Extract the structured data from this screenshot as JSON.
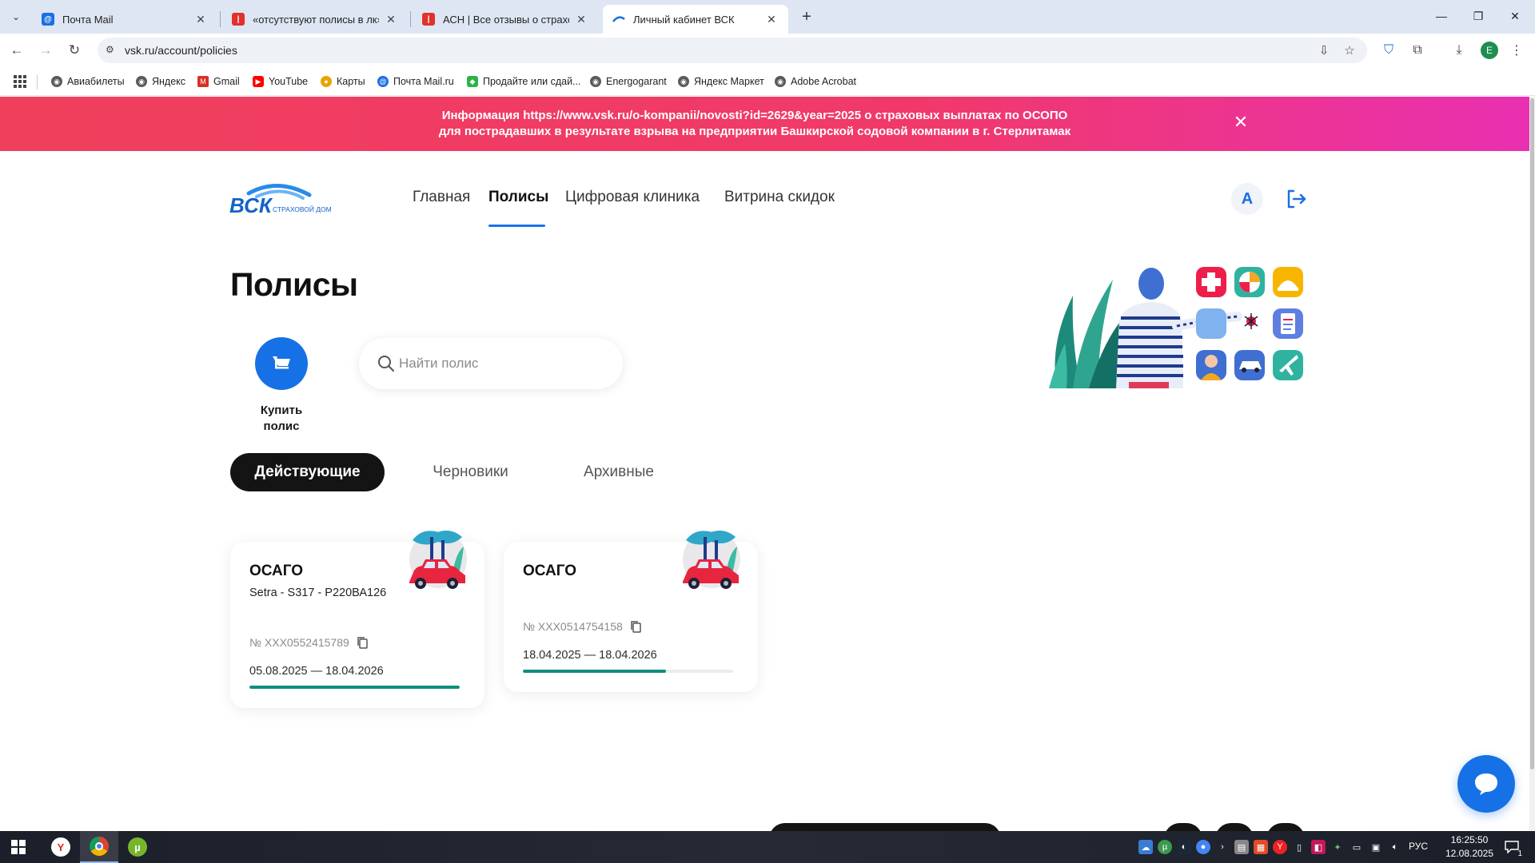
{
  "browser": {
    "tabs": [
      {
        "title": "Почта Mail",
        "favicon_color": "#1a6fe3",
        "active": false
      },
      {
        "title": "«отсутствуют полисы в лк» - о",
        "favicon_color": "#e0312c",
        "active": false
      },
      {
        "title": "АСН | Все отзывы о страховых",
        "favicon_color": "#e0312c",
        "active": false
      },
      {
        "title": "Личный кабинет ВСК",
        "favicon_color": "#1a6fe3",
        "active": true
      }
    ],
    "url": "vsk.ru/account/policies",
    "profile_initial": "E",
    "bookmarks": [
      {
        "label": "Авиабилеты",
        "color": "#5a5a5a"
      },
      {
        "label": "Яндекс",
        "color": "#5a5a5a"
      },
      {
        "label": "Gmail",
        "color": "#d93025"
      },
      {
        "label": "YouTube",
        "color": "#ff0000"
      },
      {
        "label": "Карты",
        "color": "#e8a400"
      },
      {
        "label": "Почта Mail.ru",
        "color": "#1a6fe3"
      },
      {
        "label": "Продайте или сдай...",
        "color": "#2bb34a"
      },
      {
        "label": "Energogarant",
        "color": "#5a5a5a"
      },
      {
        "label": "Яндекс Маркет",
        "color": "#5a5a5a"
      },
      {
        "label": "Adobe Acrobat",
        "color": "#5a5a5a"
      }
    ]
  },
  "banner": {
    "line1": "Информация https://www.vsk.ru/o-kompanii/novosti?id=2629&year=2025 о страховых выплатах по ОСОПО",
    "line2": "для пострадавших в результате взрыва на предприятии Башкирской содовой компании в г. Стерлитамак"
  },
  "header": {
    "logo_text": "ВСК",
    "logo_subtext": "СТРАХОВОЙ ДОМ",
    "nav": [
      "Главная",
      "Полисы",
      "Цифровая клиника",
      "Витрина скидок"
    ],
    "avatar_initial": "А"
  },
  "page": {
    "title": "Полисы",
    "buy_label_line1": "Купить",
    "buy_label_line2": "полис",
    "search_placeholder": "Найти полис",
    "filter_tabs": [
      "Действующие",
      "Черновики",
      "Архивные"
    ]
  },
  "policies": [
    {
      "type": "ОСАГО",
      "vehicle": "Setra - S317 - Р220ВА126",
      "number": "№ XXX0552415789",
      "dates": "05.08.2025 — 18.04.2026",
      "progress": 1.0
    },
    {
      "type": "ОСАГО",
      "vehicle": "",
      "number": "№ XXX0514754158",
      "dates": "18.04.2025 — 18.04.2026",
      "progress": 0.68
    }
  ],
  "taskbar": {
    "language": "РУС",
    "time": "16:25:50",
    "date": "12.08.2025",
    "notifications": "1"
  },
  "colors": {
    "accent": "#1771e6",
    "banner_start": "#f03f5c",
    "banner_end": "#e930b2",
    "progress": "#0f8f7c"
  }
}
